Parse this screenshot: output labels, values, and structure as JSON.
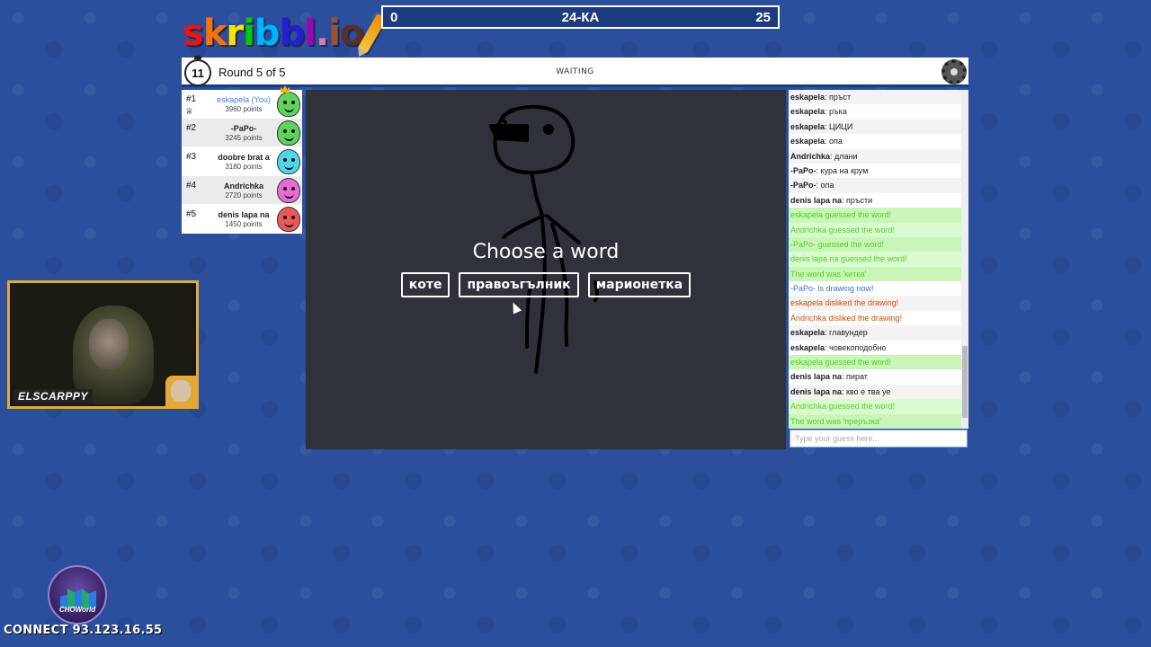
{
  "logo": {
    "letters": [
      {
        "ch": "s",
        "color": "#ef130b"
      },
      {
        "ch": "k",
        "color": "#ff7100"
      },
      {
        "ch": "r",
        "color": "#ffe400"
      },
      {
        "ch": "i",
        "color": "#00cc00"
      },
      {
        "ch": "b",
        "color": "#00b2ff"
      },
      {
        "ch": "b",
        "color": "#231fd3"
      },
      {
        "ch": "l",
        "color": "#a300ba"
      },
      {
        "ch": ".",
        "color": "#d37caa"
      },
      {
        "ch": "i",
        "color": "#a0522d"
      },
      {
        "ch": "o",
        "color": "#592f2a"
      }
    ]
  },
  "topbar": {
    "left": "0",
    "word": "24-КА",
    "right": "25"
  },
  "header": {
    "timer": "11",
    "round": "Round 5 of 5",
    "status": "WAITING"
  },
  "players": [
    {
      "rank": "#1",
      "name": "eskapela (You)",
      "points": "3960 points",
      "color": "#5ed35e",
      "you": true
    },
    {
      "rank": "#2",
      "name": "-PaPo-",
      "points": "3245 points",
      "color": "#5ed35e",
      "you": false
    },
    {
      "rank": "#3",
      "name": "doobre brat a",
      "points": "3180 points",
      "color": "#4fd6e8",
      "you": false
    },
    {
      "rank": "#4",
      "name": "Andrichka",
      "points": "2720 points",
      "color": "#e86ad6",
      "you": false
    },
    {
      "rank": "#5",
      "name": "denis lapa na",
      "points": "1450 points",
      "color": "#e85a5a",
      "you": false
    }
  ],
  "canvas": {
    "title": "Choose a word",
    "choices": [
      "коте",
      "правоъгълник",
      "марионетка"
    ]
  },
  "chat": {
    "messages": [
      {
        "author": "eskapela",
        "text": "пръст",
        "type": "normal"
      },
      {
        "author": "eskapela",
        "text": "ръка",
        "type": "normal"
      },
      {
        "author": "eskapela",
        "text": "ЦИЦИ",
        "type": "normal"
      },
      {
        "author": "eskapela",
        "text": "опа",
        "type": "normal"
      },
      {
        "author": "Andrichka",
        "text": "длани",
        "type": "normal"
      },
      {
        "author": "-PaPo-",
        "text": "кура на крум",
        "type": "normal"
      },
      {
        "author": "-PaPo-",
        "text": "опа",
        "type": "normal"
      },
      {
        "author": "denis lapa na",
        "text": "пръсти",
        "type": "normal"
      },
      {
        "author": "",
        "text": "eskapela guessed the word!",
        "type": "green"
      },
      {
        "author": "",
        "text": "Andrichka guessed the word!",
        "type": "green"
      },
      {
        "author": "",
        "text": "-PaPo- guessed the word!",
        "type": "green"
      },
      {
        "author": "",
        "text": "denis lapa na guessed the word!",
        "type": "green"
      },
      {
        "author": "",
        "text": "The word was 'китка'",
        "type": "green"
      },
      {
        "author": "",
        "text": "-PaPo- is drawing now!",
        "type": "blue"
      },
      {
        "author": "",
        "text": "eskapela disliked the drawing!",
        "type": "red"
      },
      {
        "author": "",
        "text": "Andrichka disliked the drawing!",
        "type": "red"
      },
      {
        "author": "eskapela",
        "text": "главундер",
        "type": "normal"
      },
      {
        "author": "eskapela",
        "text": "човекоподобно",
        "type": "normal"
      },
      {
        "author": "",
        "text": "eskapela guessed the word!",
        "type": "green"
      },
      {
        "author": "denis lapa na",
        "text": "пират",
        "type": "normal"
      },
      {
        "author": "denis lapa na",
        "text": "кво е тва уе",
        "type": "normal"
      },
      {
        "author": "",
        "text": "Andrichka guessed the word!",
        "type": "green"
      },
      {
        "author": "",
        "text": "The word was 'преръзка'",
        "type": "green"
      }
    ],
    "input_placeholder": "Type your guess here..."
  },
  "webcam": {
    "label": "ELSCARPPY"
  },
  "badge": {
    "text": "CHOWorld"
  },
  "connect": "CONNECT 93.123.16.55"
}
